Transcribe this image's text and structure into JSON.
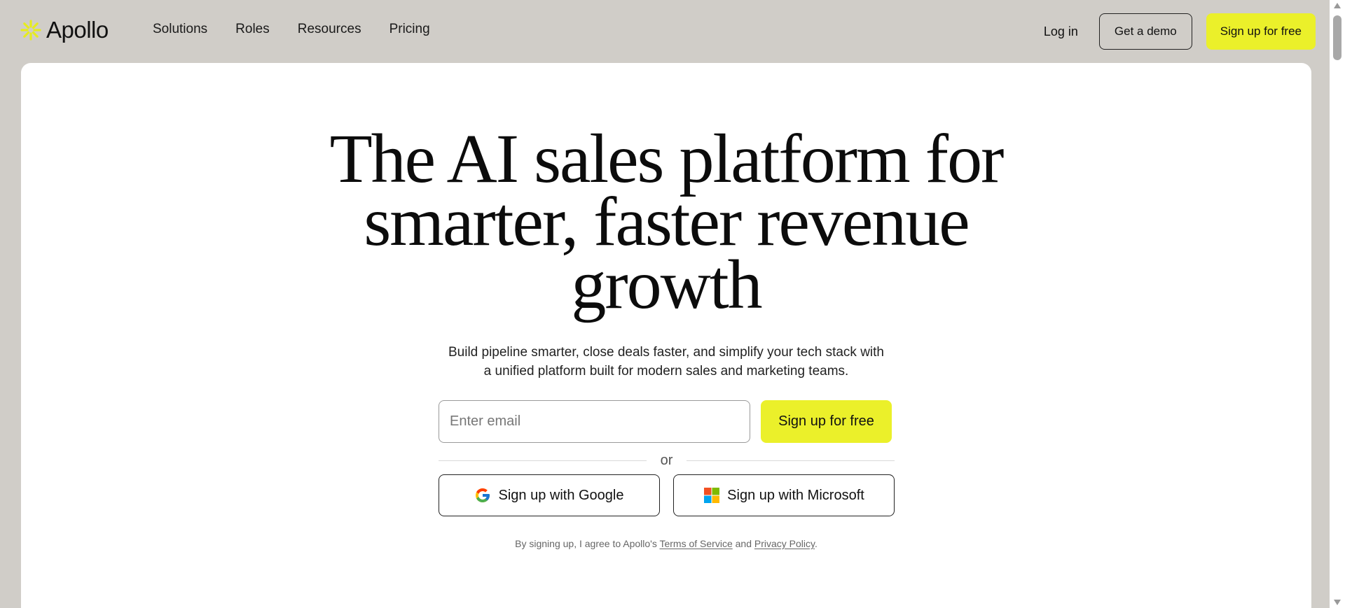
{
  "brand": {
    "name": "Apollo",
    "icon": "sunburst-logo-icon",
    "accent_color": "#ebf02a"
  },
  "nav": {
    "links": [
      "Solutions",
      "Roles",
      "Resources",
      "Pricing"
    ],
    "login_label": "Log in",
    "demo_label": "Get a demo",
    "signup_label": "Sign up for free"
  },
  "hero": {
    "headline_lines": [
      "The AI sales platform for",
      "smarter, faster revenue",
      "growth"
    ],
    "subtext_lines": [
      "Build pipeline smarter, close deals faster, and simplify your tech stack with",
      "a unified platform built for modern sales and marketing teams."
    ]
  },
  "signup_form": {
    "email_placeholder": "Enter email",
    "email_value": "",
    "submit_label": "Sign up for free",
    "divider_text": "or",
    "google_label": "Sign up with Google",
    "microsoft_label": "Sign up with Microsoft",
    "google_icon": "google-icon",
    "microsoft_icon": "microsoft-icon"
  },
  "legal": {
    "prefix": "By signing up, I agree to Apollo's ",
    "terms_label": "Terms of Service",
    "conjunction": " and ",
    "privacy_label": "Privacy Policy",
    "suffix": "."
  }
}
